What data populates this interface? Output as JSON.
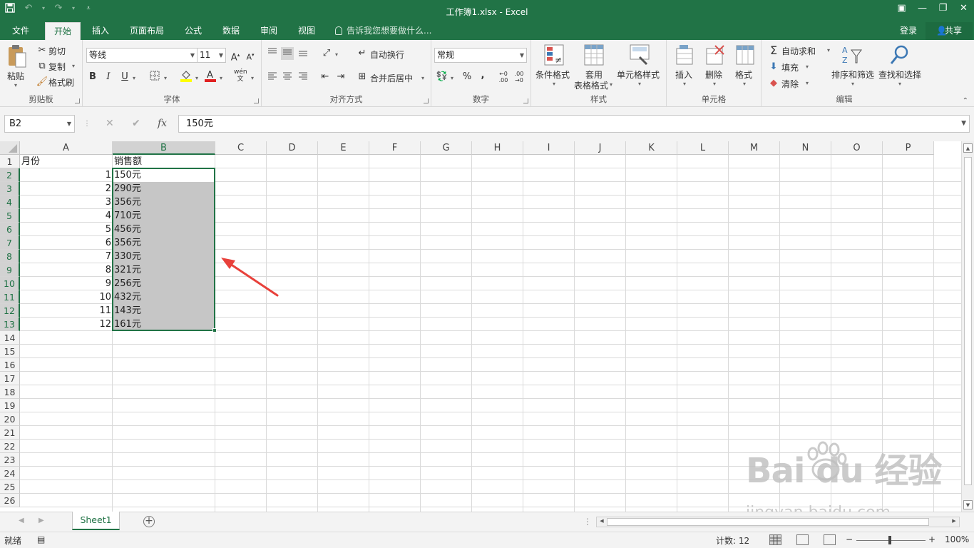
{
  "title_bar": {
    "document_title": "工作簿1.xlsx - Excel",
    "quick_access": [
      "save-icon",
      "undo-icon",
      "redo-icon",
      "customize-icon"
    ],
    "window_controls": [
      "ribbon-display-icon",
      "minimize-icon",
      "restore-icon",
      "close-icon"
    ]
  },
  "tabs": [
    "文件",
    "开始",
    "插入",
    "页面布局",
    "公式",
    "数据",
    "审阅",
    "视图"
  ],
  "active_tab": "开始",
  "tell_me": "告诉我您想要做什么...",
  "login": "登录",
  "share": "共享",
  "ribbon": {
    "clipboard": {
      "label": "剪贴板",
      "paste": "粘贴",
      "cut": "剪切",
      "copy": "复制",
      "format_painter": "格式刷"
    },
    "font": {
      "label": "字体",
      "font_name": "等线",
      "font_size": "11",
      "bold": "B",
      "italic": "I",
      "underline": "U",
      "phonetic": "wén"
    },
    "alignment": {
      "label": "对齐方式",
      "wrap_text": "自动换行",
      "merge_center": "合并后居中"
    },
    "number": {
      "label": "数字",
      "format": "常规",
      "percent": "%",
      "comma": ","
    },
    "styles": {
      "label": "样式",
      "conditional": "条件格式",
      "format_table_1": "套用",
      "format_table_2": "表格格式",
      "cell_styles": "单元格样式"
    },
    "cells": {
      "label": "单元格",
      "insert": "插入",
      "delete": "删除",
      "format": "格式"
    },
    "editing": {
      "label": "编辑",
      "autosum": "自动求和",
      "fill": "填充",
      "clear": "清除",
      "sort_filter": "排序和筛选",
      "find_select": "查找和选择"
    }
  },
  "formula_bar": {
    "name_box": "B2",
    "cancel": "✕",
    "enter": "✔",
    "fx": "fx",
    "content": "150元"
  },
  "columns": [
    "A",
    "B",
    "C",
    "D",
    "E",
    "F",
    "G",
    "H",
    "I",
    "J",
    "K",
    "L",
    "M",
    "N",
    "O",
    "P"
  ],
  "rows": [
    "1",
    "2",
    "3",
    "4",
    "5",
    "6",
    "7",
    "8",
    "9",
    "10",
    "11",
    "12",
    "13",
    "14",
    "15",
    "16",
    "17",
    "18",
    "19",
    "20",
    "21",
    "22",
    "23",
    "24",
    "25",
    "26"
  ],
  "cells": {
    "A1": "月份",
    "B1": "销售额",
    "A2": "1",
    "B2": "150元",
    "A3": "2",
    "B3": "290元",
    "A4": "3",
    "B4": "356元",
    "A5": "4",
    "B5": "710元",
    "A6": "5",
    "B6": "456元",
    "A7": "6",
    "B7": "356元",
    "A8": "7",
    "B8": "330元",
    "A9": "8",
    "B9": "321元",
    "A10": "9",
    "B10": "256元",
    "A11": "10",
    "B11": "432元",
    "A12": "11",
    "B12": "143元",
    "A13": "12",
    "B13": "161元"
  },
  "selection": {
    "range": "B2:B13",
    "active": "B2"
  },
  "annotation_arrow_color": "#e8413b",
  "sheet_tabs": [
    "Sheet1"
  ],
  "status": {
    "ready": "就绪",
    "count": "计数: 12",
    "zoom": "100%"
  },
  "watermark": {
    "brand": "Bai du 经验",
    "url": "jingyan.baidu.com"
  },
  "colors": {
    "excel_green": "#217346",
    "ribbon_bg": "#f3f3f3",
    "selection_fill": "#c6c6c6"
  }
}
